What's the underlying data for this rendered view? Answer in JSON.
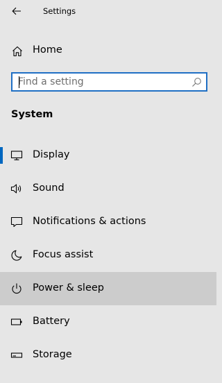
{
  "window": {
    "title": "Settings"
  },
  "home": {
    "label": "Home",
    "icon": "home-icon"
  },
  "search": {
    "placeholder": "Find a setting",
    "value": "",
    "icon": "search-icon"
  },
  "section": {
    "title": "System"
  },
  "nav": {
    "items": [
      {
        "label": "Display",
        "icon": "monitor-icon",
        "selected": true
      },
      {
        "label": "Sound",
        "icon": "speaker-icon",
        "selected": false
      },
      {
        "label": "Notifications & actions",
        "icon": "message-icon",
        "selected": false
      },
      {
        "label": "Focus assist",
        "icon": "moon-icon",
        "selected": false
      },
      {
        "label": "Power & sleep",
        "icon": "power-icon",
        "selected": false,
        "hovered": true
      },
      {
        "label": "Battery",
        "icon": "battery-icon",
        "selected": false
      },
      {
        "label": "Storage",
        "icon": "storage-icon",
        "selected": false
      }
    ]
  },
  "colors": {
    "accent": "#0067c0",
    "background": "#e6e6e6",
    "hover": "#cccccc",
    "search_border": "#1f6fc4"
  }
}
